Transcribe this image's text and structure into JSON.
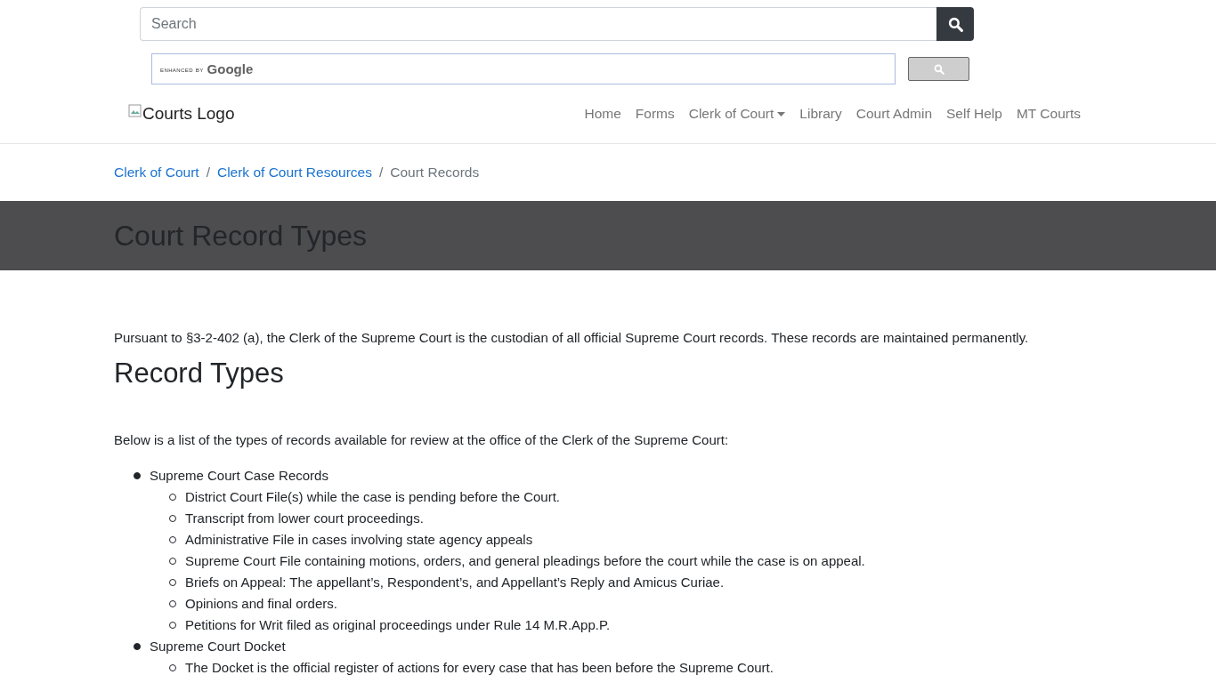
{
  "search": {
    "placeholder": "Search"
  },
  "google_search": {
    "branding_prefix": "enhanced by",
    "branding_name": "Google"
  },
  "logo": {
    "alt": "Courts Logo"
  },
  "nav": [
    {
      "label": "Home",
      "dropdown": false
    },
    {
      "label": "Forms",
      "dropdown": false
    },
    {
      "label": "Clerk of Court",
      "dropdown": true
    },
    {
      "label": "Library",
      "dropdown": false
    },
    {
      "label": "Court Admin",
      "dropdown": false
    },
    {
      "label": "Self Help",
      "dropdown": false
    },
    {
      "label": "MT Courts",
      "dropdown": false
    }
  ],
  "breadcrumb_separator": "/",
  "breadcrumb": [
    {
      "label": "Clerk of Court",
      "current": false
    },
    {
      "label": "Clerk of Court Resources",
      "current": false
    },
    {
      "label": "Court Records",
      "current": true
    }
  ],
  "page_title": "Court Record Types",
  "intro": "Pursuant to §3-2-402 (a), the Clerk of the Supreme Court is the custodian of all official Supreme Court records. These records are maintained permanently.",
  "section_heading": "Record Types",
  "list_intro": "Below is a list of the types of records available for review at the office of the Clerk of the Supreme Court:",
  "record_list": [
    {
      "label": "Supreme Court Case Records",
      "children": [
        {
          "label": "District Court File(s) while the case is pending before the Court."
        },
        {
          "label": "Transcript from lower court proceedings."
        },
        {
          "label": "Administrative File in cases involving state agency appeals"
        },
        {
          "label": "Supreme Court File containing motions, orders, and general pleadings before the court while the case is on appeal."
        },
        {
          "label": "Briefs on Appeal: The appellant’s, Respondent’s, and Appellant’s Reply and Amicus Curiae."
        },
        {
          "label": "Opinions and final orders."
        },
        {
          "label": "Petitions for Writ filed as original proceedings under Rule 14 M.R.App.P."
        }
      ]
    },
    {
      "label": "Supreme Court Docket",
      "children": [
        {
          "label": "The Docket is the official register of actions for every case that has been before the Supreme Court."
        }
      ]
    }
  ]
}
